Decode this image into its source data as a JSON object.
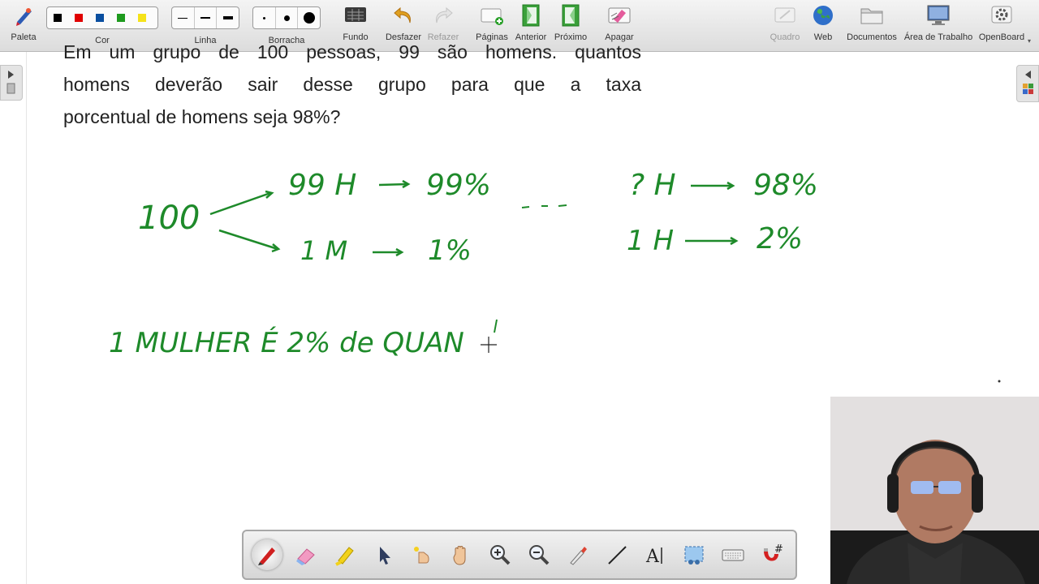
{
  "toolbar": {
    "paleta": "Paleta",
    "cor": "Cor",
    "linha": "Linha",
    "borracha": "Borracha",
    "fundo": "Fundo",
    "desfazer": "Desfazer",
    "refazer": "Refazer",
    "paginas": "Páginas",
    "anterior": "Anterior",
    "proximo": "Próximo",
    "apagar": "Apagar",
    "quadro": "Quadro",
    "web": "Web",
    "documentos": "Documentos",
    "area_trabalho": "Área de Trabalho",
    "openboard": "OpenBoard"
  },
  "colors": {
    "ink": "#1e8a2a",
    "swatches": [
      "#000000",
      "#e00000",
      "#0a4fa0",
      "#1e9a1e",
      "#f5e21a"
    ]
  },
  "question": {
    "line1": "Em um grupo de 100 pessoas, 99 são homens. quantos",
    "line2": "homens deverão sair desse grupo para que a taxa",
    "line3": "porcentual de homens seja 98%?"
  },
  "handwriting": {
    "total": "100",
    "left_top": "99 H",
    "left_top_pct": "99%",
    "left_bottom": "1 M",
    "left_bottom_pct": "1%",
    "right_top": "? H",
    "right_top_pct": "98%",
    "right_bottom": "1 H",
    "right_bottom_pct": "2%",
    "sentence": "1 MULHER É 2% de QUAN"
  },
  "icons": {
    "bottom_tools": [
      "pen-icon",
      "eraser-icon",
      "highlighter-icon",
      "pointer-icon",
      "laser-icon",
      "hand-icon",
      "zoom-in-icon",
      "zoom-out-icon",
      "pipette-icon",
      "line-icon",
      "text-icon",
      "capture-icon",
      "keyboard-icon",
      "magnet-icon"
    ]
  }
}
